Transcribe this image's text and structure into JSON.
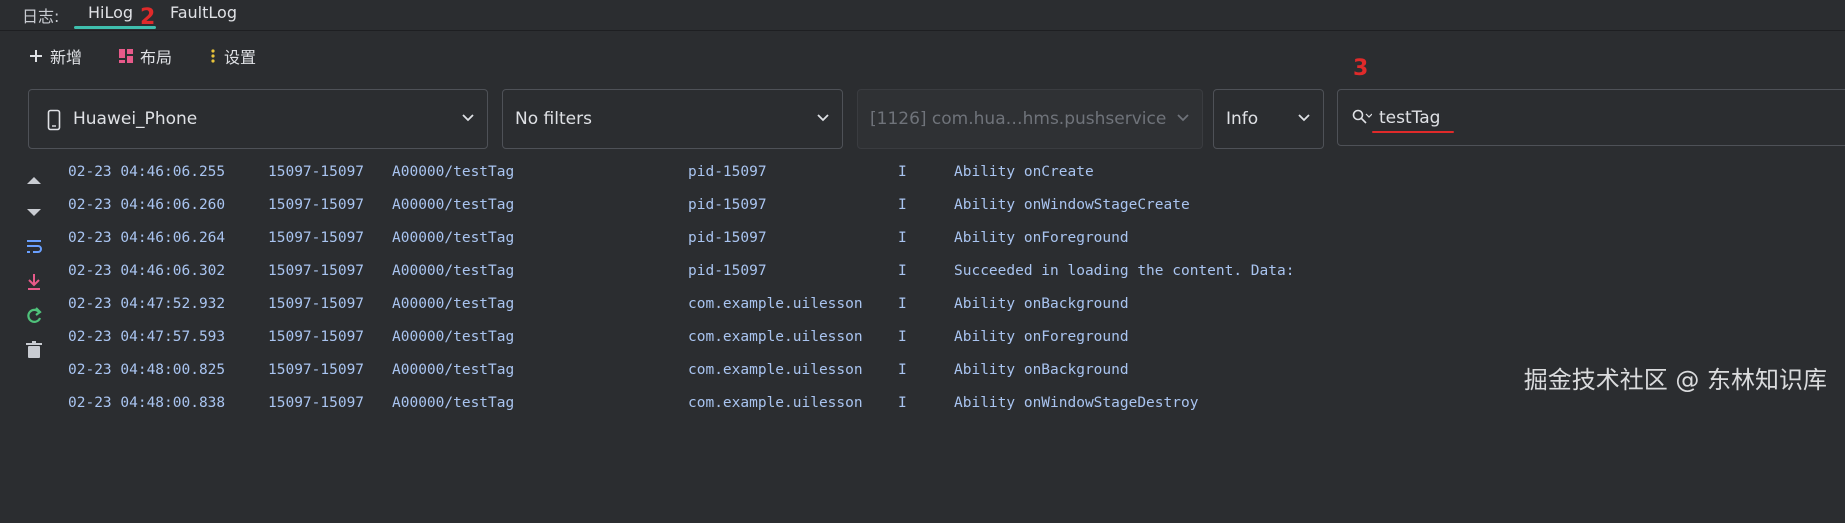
{
  "header": {
    "label": "日志:",
    "tabs": [
      {
        "label": "HiLog",
        "active": true
      },
      {
        "label": "FaultLog",
        "active": false
      }
    ]
  },
  "annotations": {
    "tab_marker": "2",
    "search_marker": "3"
  },
  "toolbar": {
    "add_label": "新增",
    "layout_label": "布局",
    "settings_label": "设置"
  },
  "filters": {
    "device": "Huawei_Phone",
    "filter": "No filters",
    "process": "[1126] com.hua…hms.pushservice",
    "level": "Info",
    "search_value": "testTag"
  },
  "log_rows": [
    {
      "time": "02-23 04:46:06.255",
      "pid": "15097-15097",
      "tag": "A00000/testTag",
      "pkg": "pid-15097",
      "level": "I",
      "msg": "Ability onCreate"
    },
    {
      "time": "02-23 04:46:06.260",
      "pid": "15097-15097",
      "tag": "A00000/testTag",
      "pkg": "pid-15097",
      "level": "I",
      "msg": "Ability onWindowStageCreate"
    },
    {
      "time": "02-23 04:46:06.264",
      "pid": "15097-15097",
      "tag": "A00000/testTag",
      "pkg": "pid-15097",
      "level": "I",
      "msg": "Ability onForeground"
    },
    {
      "time": "02-23 04:46:06.302",
      "pid": "15097-15097",
      "tag": "A00000/testTag",
      "pkg": "pid-15097",
      "level": "I",
      "msg": "Succeeded in loading the content. Data:"
    },
    {
      "time": "02-23 04:47:52.932",
      "pid": "15097-15097",
      "tag": "A00000/testTag",
      "pkg": "com.example.uilesson",
      "level": "I",
      "msg": "Ability onBackground"
    },
    {
      "time": "02-23 04:47:57.593",
      "pid": "15097-15097",
      "tag": "A00000/testTag",
      "pkg": "com.example.uilesson",
      "level": "I",
      "msg": "Ability onForeground"
    },
    {
      "time": "02-23 04:48:00.825",
      "pid": "15097-15097",
      "tag": "A00000/testTag",
      "pkg": "com.example.uilesson",
      "level": "I",
      "msg": "Ability onBackground"
    },
    {
      "time": "02-23 04:48:00.838",
      "pid": "15097-15097",
      "tag": "A00000/testTag",
      "pkg": "com.example.uilesson",
      "level": "I",
      "msg": "Ability onWindowStageDestroy"
    }
  ],
  "watermark": "掘金技术社区 @ 东林知识库",
  "colors": {
    "accent": "#3fbfae",
    "log_text": "#a9c4f0",
    "annotation_red": "#e02a2a",
    "background": "#2b2d30"
  }
}
